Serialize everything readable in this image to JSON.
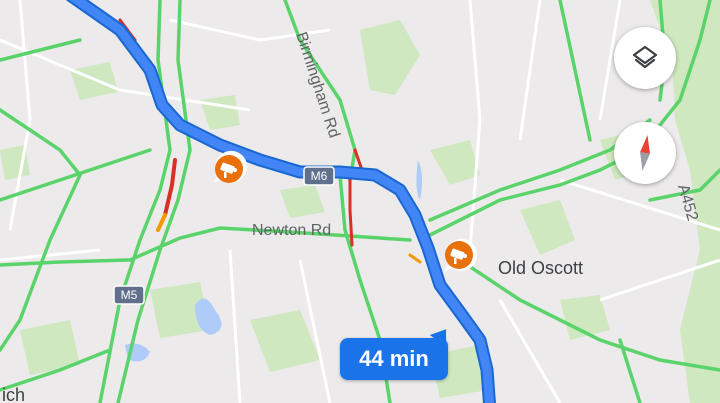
{
  "map": {
    "roads": {
      "birmingham_rd": "Birmingham Rd",
      "newton_rd": "Newton Rd",
      "a452": "A452"
    },
    "shields": {
      "m6": "M6",
      "m5": "M5"
    },
    "places": {
      "old_oscott": "Old Oscott",
      "partial_bottom_left": "ich"
    }
  },
  "route": {
    "eta_label": "44 min",
    "color": "#4285f4"
  },
  "controls": {
    "layers_icon": "layers-icon",
    "compass_icon": "compass-icon"
  },
  "markers": {
    "icon": "speed-camera-icon",
    "color": "#e8710a",
    "count": 2
  },
  "colors": {
    "traffic_free": "#5bd36b",
    "traffic_slow": "#f29900",
    "traffic_heavy": "#d93025",
    "park": "#c8e6b4",
    "water": "#aecbfa"
  }
}
